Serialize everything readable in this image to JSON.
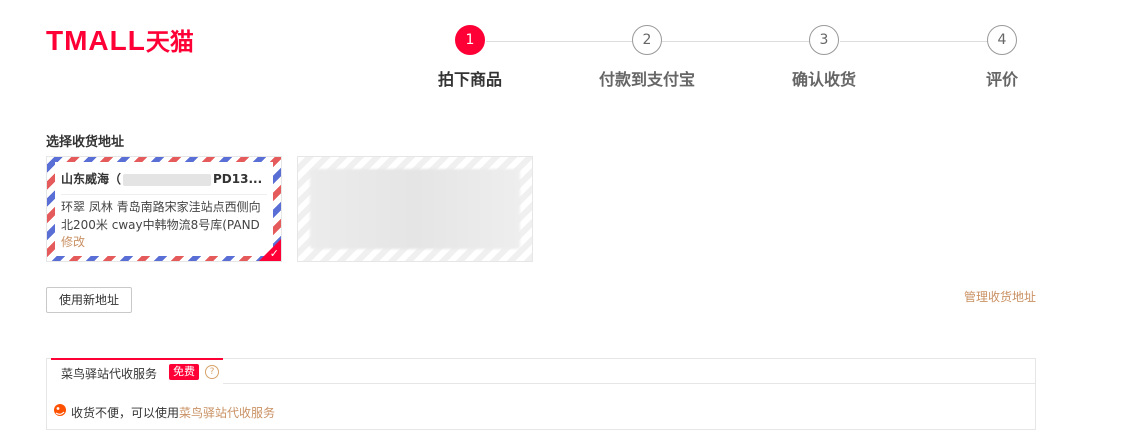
{
  "logo": {
    "text_latin": "TMALL",
    "text_cn": "天猫",
    "color": "#ff0036"
  },
  "steps": [
    {
      "number": "1",
      "label": "拍下商品"
    },
    {
      "number": "2",
      "label": "付款到支付宝"
    },
    {
      "number": "3",
      "label": "确认收货"
    },
    {
      "number": "4",
      "label": "评价"
    }
  ],
  "address_section": {
    "title": "选择收货地址",
    "selected_card": {
      "name_prefix": "山东威海（",
      "name_suffix": "PD13...",
      "address": "环翠 凤林 青岛南路宋家洼站点西侧向北200米 cway中韩物流8号库(PAND",
      "modify_label": "修改"
    },
    "new_address_button": "使用新地址",
    "manage_link": "管理收货地址"
  },
  "service": {
    "tab_title": "菜鸟驿站代收服务",
    "free_badge": "免费",
    "help_icon": "?",
    "message_prefix": "收货不便，可以使用",
    "message_link": "菜鸟驿站代收服务"
  },
  "colors": {
    "accent": "#ff0036",
    "link": "#c99163"
  }
}
